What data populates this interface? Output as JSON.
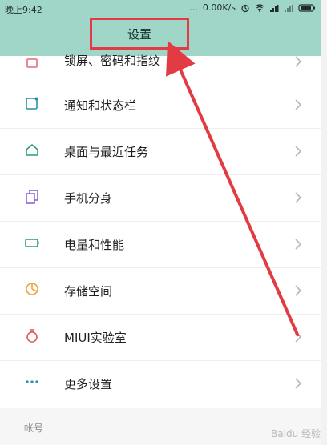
{
  "status_bar": {
    "left_text": "晚上9:42",
    "dots": "...",
    "speed": "0.00K/s",
    "battery_icon": "battery-icon"
  },
  "header": {
    "title": "设置",
    "highlight_color": "#e23b43",
    "bg_color": "#9fd6c7"
  },
  "list": {
    "partial_row_label": "锁屏、密码和指纹",
    "rows": [
      {
        "label": "通知和状态栏",
        "icon": "notification-icon"
      },
      {
        "label": "桌面与最近任务",
        "icon": "home-icon"
      },
      {
        "label": "手机分身",
        "icon": "clone-icon"
      },
      {
        "label": "电量和性能",
        "icon": "battery-icon"
      },
      {
        "label": "存储空间",
        "icon": "storage-icon"
      },
      {
        "label": "MIUI实验室",
        "icon": "lab-icon"
      },
      {
        "label": "更多设置",
        "icon": "more-icon"
      }
    ]
  },
  "section": {
    "title": "帐号"
  },
  "watermark": {
    "text": "Baidu 经验"
  }
}
